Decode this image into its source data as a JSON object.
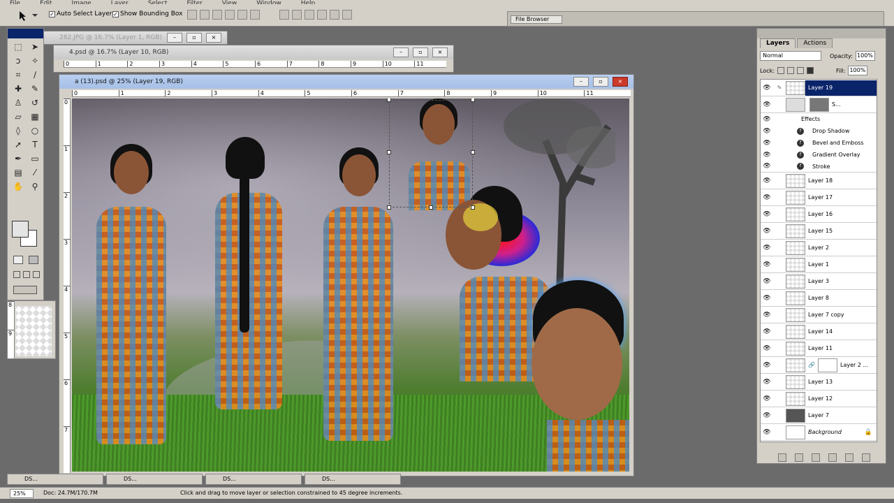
{
  "options": {
    "auto_select_layer": "Auto Select Layer",
    "show_bounding_box": "Show Bounding Box",
    "file_browser": "File Browser"
  },
  "windows": {
    "back": {
      "title": "282.JPG @ 16.7% (Layer 1, RGB)"
    },
    "mid": {
      "title": "4.psd @ 16.7% (Layer 10, RGB)"
    },
    "active": {
      "title": "a (13).psd @ 25% (Layer 19, RGB)"
    }
  },
  "rulers": {
    "mid": [
      "0",
      "1",
      "2",
      "3",
      "4",
      "5",
      "6",
      "7",
      "8",
      "9",
      "10",
      "11"
    ],
    "active": [
      "0",
      "1",
      "2",
      "3",
      "4",
      "5",
      "6",
      "7",
      "8",
      "9",
      "10",
      "11"
    ],
    "vert": [
      "0",
      "1",
      "2",
      "3",
      "4",
      "5",
      "6",
      "7"
    ],
    "toolbox_vert": [
      "8",
      "9"
    ]
  },
  "taskbar": [
    "DS...",
    "DS...",
    "DS...",
    "DS..."
  ],
  "status": {
    "zoom": "25%",
    "doc": "Doc: 24.7M/170.7M",
    "hint": "Click and drag to move layer or selection constrained to 45 degree increments."
  },
  "layers_panel": {
    "tabs": [
      "Layers",
      "Actions"
    ],
    "blend_mode": "Normal",
    "opacity_label": "Opacity:",
    "opacity": "100%",
    "lock_label": "Lock:",
    "fill_label": "Fill:",
    "fill": "100%",
    "selected": "Layer 19",
    "shape_layer": "S...",
    "effects": [
      "Effects",
      "Drop Shadow",
      "Bevel and Emboss",
      "Gradient Overlay",
      "Stroke"
    ],
    "layers": [
      "Layer 18",
      "Layer 17",
      "Layer 16",
      "Layer 15",
      "Layer 2",
      "Layer 1",
      "Layer 3",
      "Layer 8",
      "Layer 7 copy",
      "Layer 14",
      "Layer 11",
      "Layer 2 ...",
      "Layer 13",
      "Layer 12",
      "Layer 7",
      "Background"
    ]
  },
  "colors": {
    "selection": "#0a246a",
    "close": "#cc3a2a"
  }
}
